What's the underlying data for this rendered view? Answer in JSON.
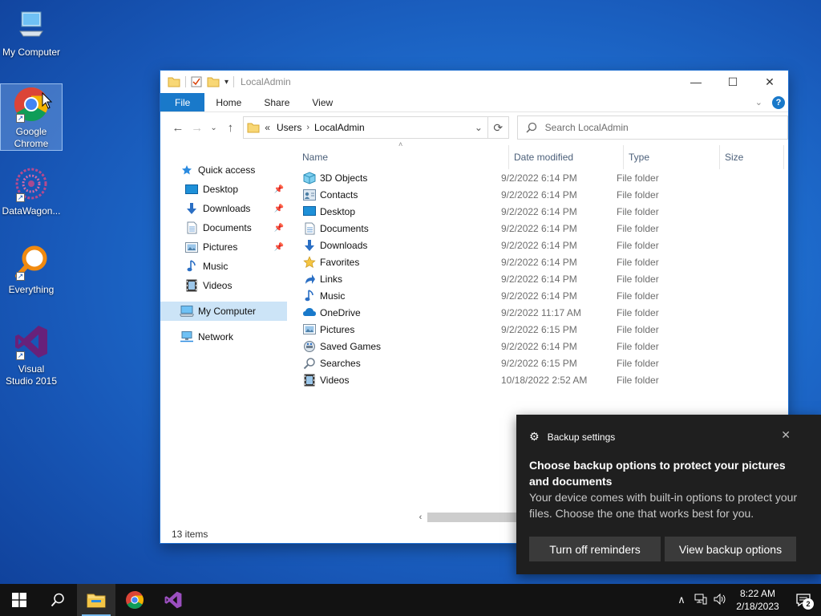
{
  "desktop": {
    "icons": [
      {
        "label": "My Computer",
        "icon": "my-computer-icon"
      },
      {
        "label": "Google Chrome",
        "icon": "chrome-icon"
      },
      {
        "label": "DataWagon...",
        "icon": "datawagon-icon"
      },
      {
        "label": "Everything",
        "icon": "everything-icon"
      },
      {
        "label": "Visual Studio 2015",
        "icon": "visual-studio-icon"
      }
    ]
  },
  "explorer": {
    "title": "LocalAdmin",
    "ribbon_tabs": [
      "File",
      "Home",
      "Share",
      "View"
    ],
    "address": {
      "overflow": "«",
      "parts": [
        "Users",
        "LocalAdmin"
      ]
    },
    "search_placeholder": "Search LocalAdmin",
    "nav": {
      "quick_access": "Quick access",
      "items": [
        {
          "label": "Desktop",
          "icon": "desktop-icon",
          "pinned": true
        },
        {
          "label": "Downloads",
          "icon": "downloads-icon",
          "pinned": true
        },
        {
          "label": "Documents",
          "icon": "documents-icon",
          "pinned": true
        },
        {
          "label": "Pictures",
          "icon": "pictures-icon",
          "pinned": true
        },
        {
          "label": "Music",
          "icon": "music-icon",
          "pinned": false
        },
        {
          "label": "Videos",
          "icon": "videos-icon",
          "pinned": false
        }
      ],
      "my_computer": "My Computer",
      "network": "Network"
    },
    "columns": [
      "Name",
      "Date modified",
      "Type",
      "Size"
    ],
    "files": [
      {
        "name": "3D Objects",
        "date": "9/2/2022 6:14 PM",
        "type": "File folder",
        "icon": "3d-objects-icon"
      },
      {
        "name": "Contacts",
        "date": "9/2/2022 6:14 PM",
        "type": "File folder",
        "icon": "contacts-icon"
      },
      {
        "name": "Desktop",
        "date": "9/2/2022 6:14 PM",
        "type": "File folder",
        "icon": "desktop-icon"
      },
      {
        "name": "Documents",
        "date": "9/2/2022 6:14 PM",
        "type": "File folder",
        "icon": "documents-icon"
      },
      {
        "name": "Downloads",
        "date": "9/2/2022 6:14 PM",
        "type": "File folder",
        "icon": "downloads-icon"
      },
      {
        "name": "Favorites",
        "date": "9/2/2022 6:14 PM",
        "type": "File folder",
        "icon": "favorites-icon"
      },
      {
        "name": "Links",
        "date": "9/2/2022 6:14 PM",
        "type": "File folder",
        "icon": "links-icon"
      },
      {
        "name": "Music",
        "date": "9/2/2022 6:14 PM",
        "type": "File folder",
        "icon": "music-icon"
      },
      {
        "name": "OneDrive",
        "date": "9/2/2022 11:17 AM",
        "type": "File folder",
        "icon": "onedrive-icon"
      },
      {
        "name": "Pictures",
        "date": "9/2/2022 6:15 PM",
        "type": "File folder",
        "icon": "pictures-icon"
      },
      {
        "name": "Saved Games",
        "date": "9/2/2022 6:14 PM",
        "type": "File folder",
        "icon": "saved-games-icon"
      },
      {
        "name": "Searches",
        "date": "9/2/2022 6:15 PM",
        "type": "File folder",
        "icon": "searches-icon"
      },
      {
        "name": "Videos",
        "date": "10/18/2022 2:52 AM",
        "type": "File folder",
        "icon": "videos-icon"
      }
    ],
    "status": "13 items"
  },
  "toast": {
    "app": "Backup settings",
    "title": "Choose backup options to protect your pictures and documents",
    "body": "Your device comes with built-in options to protect your files. Choose the one that works best for you.",
    "button_left": "Turn off reminders",
    "button_right": "View backup options"
  },
  "taskbar": {
    "time": "8:22 AM",
    "date": "2/18/2023",
    "notification_count": "2"
  },
  "colors": {
    "accent": "#1979ca",
    "folder": "#f8d775",
    "toast_bg": "#1f1f1f",
    "taskbar_bg": "#121212"
  }
}
